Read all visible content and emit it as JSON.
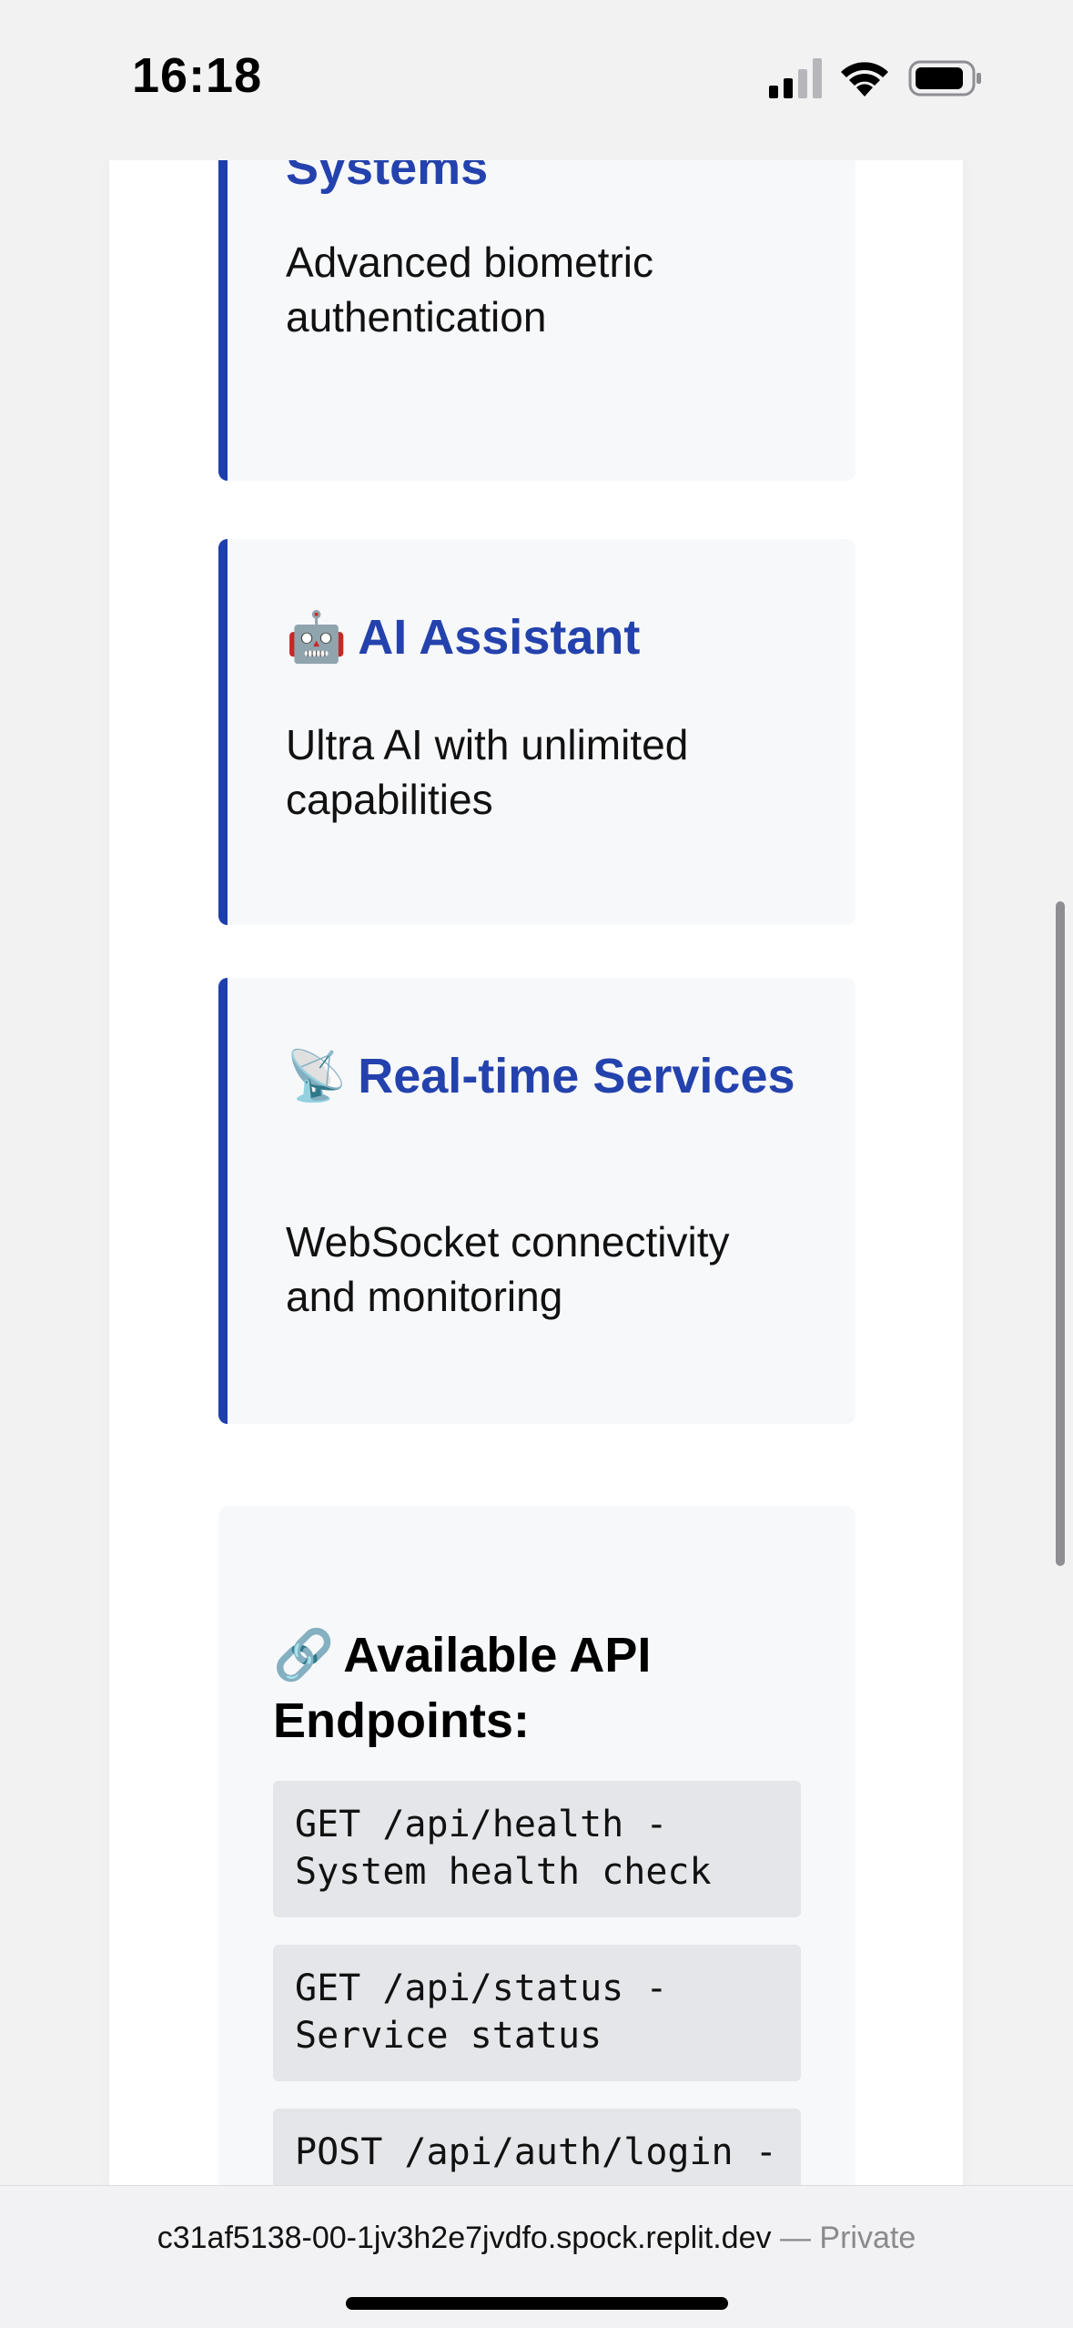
{
  "status_bar": {
    "time": "16:18"
  },
  "features": [
    {
      "emoji": "",
      "title": "Systems",
      "description": "Advanced biometric authentication"
    },
    {
      "emoji": "🤖",
      "title": "AI Assistant",
      "description": "Ultra AI with unlimited capabilities"
    },
    {
      "emoji": "📡",
      "title": "Real-time Services",
      "description": "WebSocket connectivity and monitoring"
    }
  ],
  "api_section": {
    "emoji": "🔗",
    "heading": "Available API Endpoints:",
    "endpoints": [
      "GET /api/health - System health check",
      "GET /api/status - Service status",
      "POST /api/auth/login -"
    ]
  },
  "browser": {
    "url": "c31af5138-00-1jv3h2e7jvdfo.spock.replit.dev",
    "separator": " — ",
    "privacy_label": "Private"
  },
  "colors": {
    "accent": "#1e3fae",
    "title_blue": "#2442ad",
    "card_background": "#f7f8fa",
    "code_background": "#e5e6ea"
  },
  "icons": {
    "signal": "cellular-signal-icon",
    "wifi": "wifi-icon",
    "battery": "battery-icon"
  }
}
